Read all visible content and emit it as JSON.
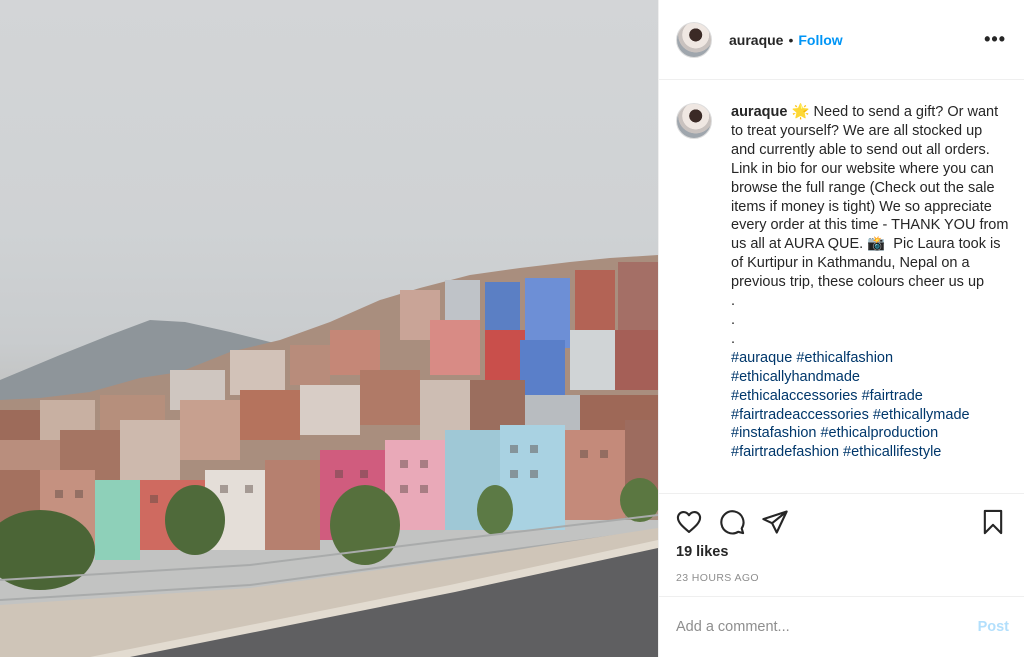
{
  "post": {
    "username": "auraque",
    "separator": "•",
    "follow_label": "Follow",
    "more_label": "•••"
  },
  "caption": {
    "username": "auraque",
    "emoji": "🌟",
    "text": "Need to send a gift? Or want to treat yourself? We are all stocked up and currently able to send out all orders. Link in bio for our website where you can browse the full range (Check out the sale items if money is tight) We so appreciate every order at this time - THANK YOU from us all at AURA QUE. 📸  Pic Laura took is of Kurtipur in Kathmandu, Nepal on a previous trip, these colours cheer us up\n.\n.\n.\n",
    "hashtags": [
      "#auraque",
      "#ethicalfashion",
      "#ethicallyhandmade",
      "#ethicalaccessories",
      "#fairtrade",
      "#fairtradeaccessories",
      "#ethicallymade",
      "#instafashion",
      "#ethicalproduction",
      "#fairtradefashion",
      "#ethicallifestyle"
    ]
  },
  "engagement": {
    "likes": "19 likes",
    "timestamp": "23 HOURS AGO"
  },
  "comment": {
    "placeholder": "Add a comment...",
    "post_label": "Post"
  },
  "icons": {
    "like": "heart-icon",
    "comment": "comment-bubble-icon",
    "share": "paper-plane-icon",
    "save": "bookmark-icon"
  },
  "colors": {
    "accent": "#0095f6",
    "hashtag": "#00376b",
    "post_disabled": "#b2dffc",
    "muted": "#8e8e8e"
  }
}
